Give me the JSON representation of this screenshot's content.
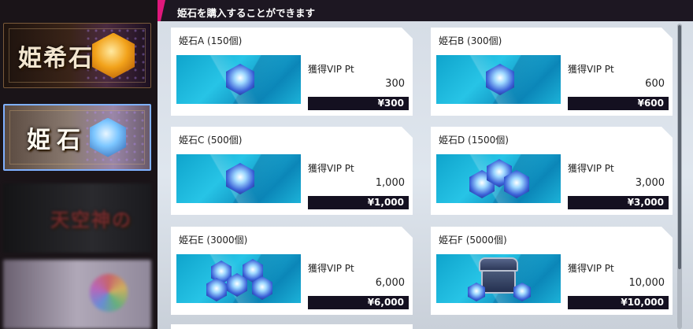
{
  "header": {
    "title": "姫石を購入することができます"
  },
  "sidebar": {
    "categories": [
      {
        "label": "姫希石"
      },
      {
        "label": "姫石"
      },
      {
        "label": "天空神の"
      },
      {
        "label": ""
      }
    ]
  },
  "products": [
    {
      "name": "姫石A (150個)",
      "vip_label": "獲得VIP Pt",
      "vip_value": "300",
      "price": "¥300"
    },
    {
      "name": "姫石B (300個)",
      "vip_label": "獲得VIP Pt",
      "vip_value": "600",
      "price": "¥600"
    },
    {
      "name": "姫石C (500個)",
      "vip_label": "獲得VIP Pt",
      "vip_value": "1,000",
      "price": "¥1,000"
    },
    {
      "name": "姫石D (1500個)",
      "vip_label": "獲得VIP Pt",
      "vip_value": "3,000",
      "price": "¥3,000"
    },
    {
      "name": "姫石E (3000個)",
      "vip_label": "獲得VIP Pt",
      "vip_value": "6,000",
      "price": "¥6,000"
    },
    {
      "name": "姫石F (5000個)",
      "vip_label": "獲得VIP Pt",
      "vip_value": "10,000",
      "price": "¥10,000"
    }
  ]
}
